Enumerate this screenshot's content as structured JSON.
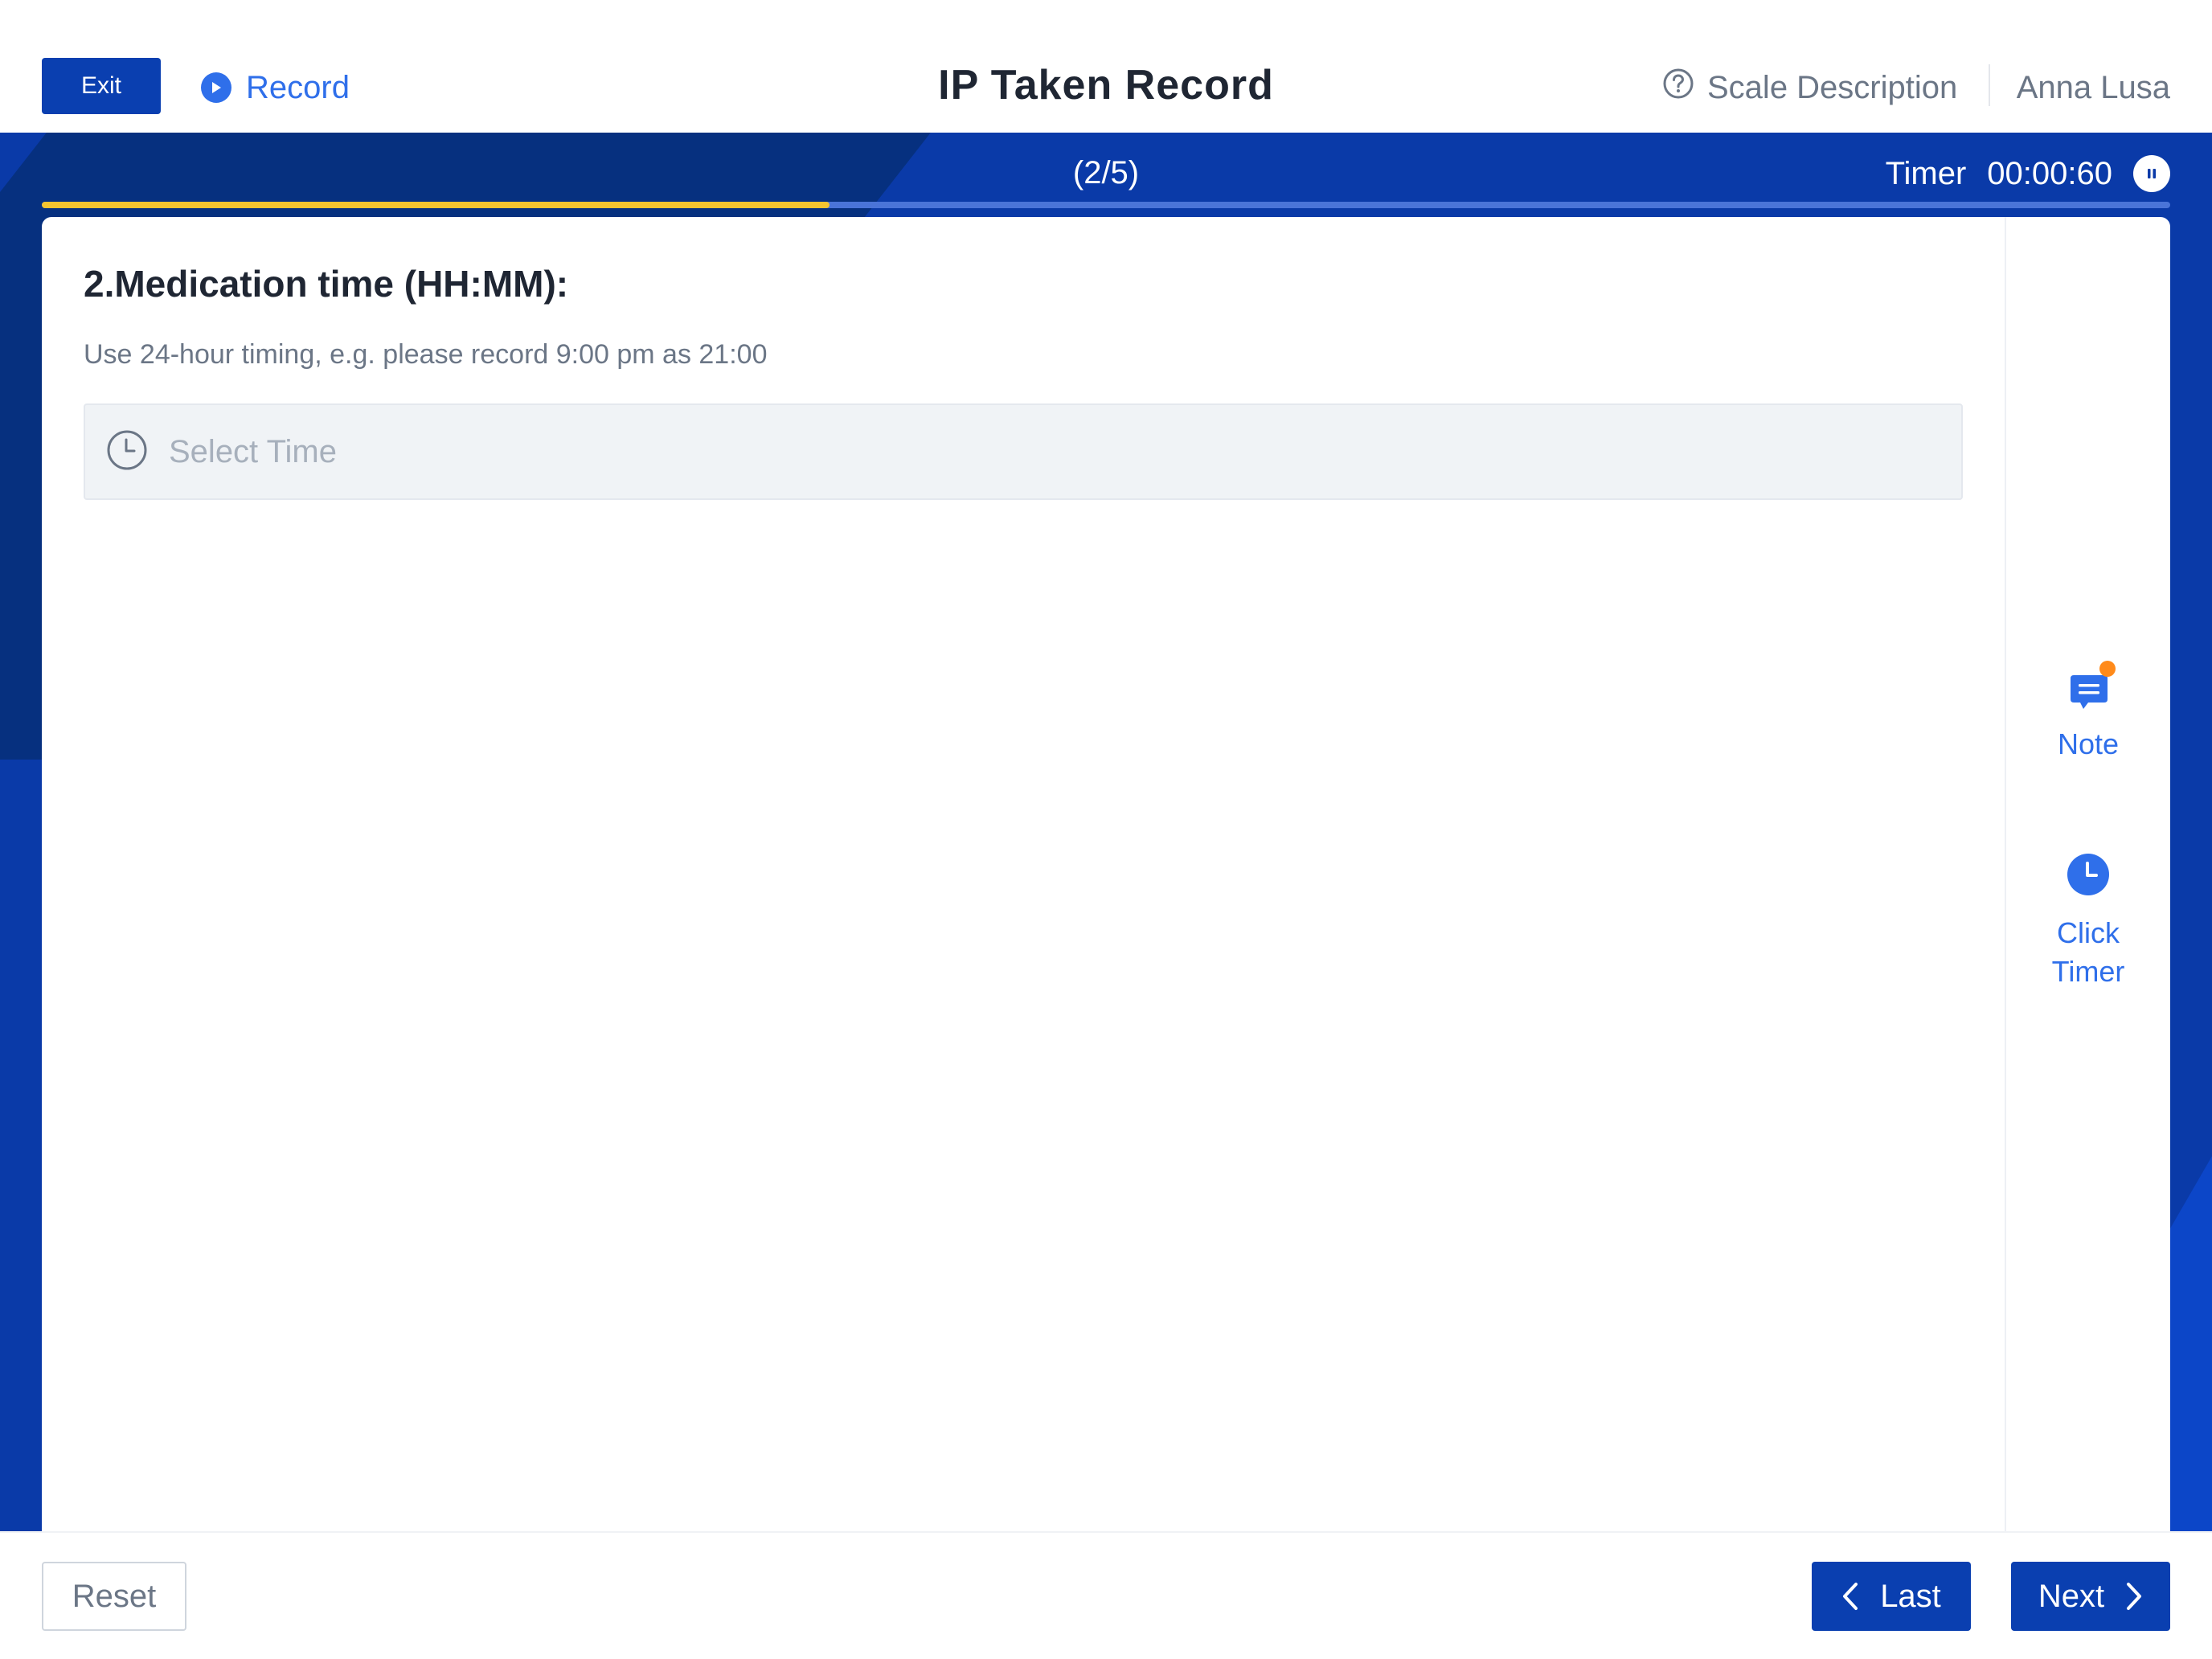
{
  "header": {
    "exit_label": "Exit",
    "record_label": "Record",
    "title": "IP Taken Record",
    "scale_description_label": "Scale Description",
    "user_name": "Anna Lusa"
  },
  "progress": {
    "step_text": "(2/5)",
    "fraction": 0.37,
    "timer_label": "Timer",
    "timer_value": "00:00:60"
  },
  "question": {
    "title": "2.Medication time (HH:MM):",
    "hint": "Use 24-hour timing, e.g. please record 9:00 pm as 21:00",
    "time_placeholder": "Select Time"
  },
  "side_panel": {
    "note_label": "Note",
    "click_timer_line1": "Click",
    "click_timer_line2": "Timer"
  },
  "footer": {
    "reset_label": "Reset",
    "last_label": "Last",
    "next_label": "Next"
  },
  "colors": {
    "primary": "#0a3fb0",
    "accent_blue": "#2f6fea",
    "progress_fill": "#f4c430",
    "notification_dot": "#ff8a1a"
  },
  "icons": [
    "play-icon",
    "help-circle-icon",
    "pause-icon",
    "clock-icon",
    "note-icon",
    "timer-icon",
    "chevron-left-icon",
    "chevron-right-icon"
  ]
}
